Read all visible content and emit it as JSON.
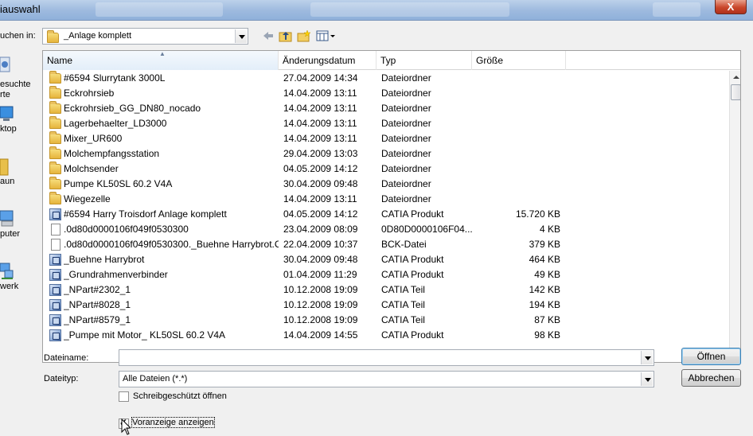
{
  "window": {
    "title": "iauswahl",
    "close_label": "X"
  },
  "look_in": {
    "label": "uchen in:",
    "value": "_Anlage komplett"
  },
  "places": [
    {
      "label": "esuchte\nrte",
      "icon": "recent-places-icon"
    },
    {
      "label": "ktop",
      "icon": "desktop-icon"
    },
    {
      "label": "aun",
      "icon": "user-folder-icon"
    },
    {
      "label": "puter",
      "icon": "computer-icon"
    },
    {
      "label": "werk",
      "icon": "network-icon"
    }
  ],
  "columns": {
    "name": "Name",
    "date": "Änderungsdatum",
    "type": "Typ",
    "size": "Größe"
  },
  "files": [
    {
      "name": "#6594 Slurrytank 3000L",
      "date": "27.04.2009 14:34",
      "type": "Dateiordner",
      "size": "",
      "icon": "folder"
    },
    {
      "name": "Eckrohrsieb",
      "date": "14.04.2009 13:11",
      "type": "Dateiordner",
      "size": "",
      "icon": "folder"
    },
    {
      "name": "Eckrohrsieb_GG_DN80_nocado",
      "date": "14.04.2009 13:11",
      "type": "Dateiordner",
      "size": "",
      "icon": "folder"
    },
    {
      "name": "Lagerbehaelter_LD3000",
      "date": "14.04.2009 13:11",
      "type": "Dateiordner",
      "size": "",
      "icon": "folder"
    },
    {
      "name": "Mixer_UR600",
      "date": "14.04.2009 13:11",
      "type": "Dateiordner",
      "size": "",
      "icon": "folder"
    },
    {
      "name": "Molchempfangsstation",
      "date": "29.04.2009 13:03",
      "type": "Dateiordner",
      "size": "",
      "icon": "folder"
    },
    {
      "name": "Molchsender",
      "date": "04.05.2009 14:12",
      "type": "Dateiordner",
      "size": "",
      "icon": "folder"
    },
    {
      "name": "Pumpe KL50SL 60.2 V4A",
      "date": "30.04.2009 09:48",
      "type": "Dateiordner",
      "size": "",
      "icon": "folder"
    },
    {
      "name": "Wiegezelle",
      "date": "14.04.2009 13:11",
      "type": "Dateiordner",
      "size": "",
      "icon": "folder"
    },
    {
      "name": "#6594 Harry Troisdorf Anlage komplett",
      "date": "04.05.2009 14:12",
      "type": "CATIA Produkt",
      "size": "15.720 KB",
      "icon": "catia"
    },
    {
      "name": ".0d80d0000106f049f0530300",
      "date": "23.04.2009 08:09",
      "type": "0D80D0000106F04...",
      "size": "4 KB",
      "icon": "file"
    },
    {
      "name": ".0d80d0000106f049f0530300._Buehne Harrybrot.C...",
      "date": "22.04.2009 10:37",
      "type": "BCK-Datei",
      "size": "379 KB",
      "icon": "file"
    },
    {
      "name": "_Buehne Harrybrot",
      "date": "30.04.2009 09:48",
      "type": "CATIA Produkt",
      "size": "464 KB",
      "icon": "catia"
    },
    {
      "name": "_Grundrahmenverbinder",
      "date": "01.04.2009 11:29",
      "type": "CATIA Produkt",
      "size": "49 KB",
      "icon": "catia"
    },
    {
      "name": "_NPart#2302_1",
      "date": "10.12.2008 19:09",
      "type": "CATIA Teil",
      "size": "142 KB",
      "icon": "catia"
    },
    {
      "name": "_NPart#8028_1",
      "date": "10.12.2008 19:09",
      "type": "CATIA Teil",
      "size": "194 KB",
      "icon": "catia"
    },
    {
      "name": "_NPart#8579_1",
      "date": "10.12.2008 19:09",
      "type": "CATIA Teil",
      "size": "87 KB",
      "icon": "catia"
    },
    {
      "name": "_Pumpe mit Motor_ KL50SL 60.2 V4A",
      "date": "14.04.2009 14:55",
      "type": "CATIA Produkt",
      "size": "98 KB",
      "icon": "catia"
    }
  ],
  "filename": {
    "label": "Dateiname:",
    "value": ""
  },
  "filetype": {
    "label": "Dateityp:",
    "value": "Alle Dateien (*.*)"
  },
  "readonly": {
    "label": "Schreibgeschützt öffnen",
    "checked": false
  },
  "preview": {
    "label": "Voranzeige anzeigen",
    "checked": true
  },
  "buttons": {
    "open": "Öffnen",
    "cancel": "Abbrechen"
  }
}
